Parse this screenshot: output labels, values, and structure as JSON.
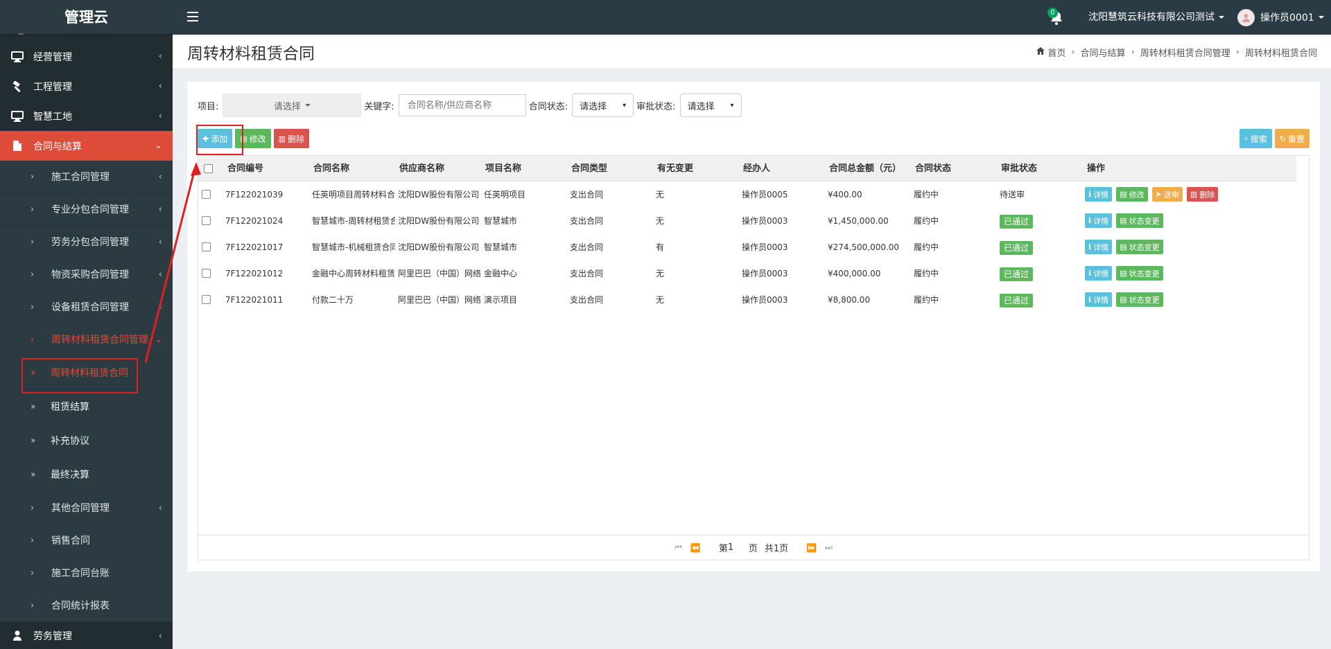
{
  "app": {
    "title": "管理云"
  },
  "sidebar": {
    "top_items": [
      {
        "label": "经营管理",
        "icon": "monitor-icon"
      },
      {
        "label": "工程管理",
        "icon": "hammer-icon"
      },
      {
        "label": "智慧工地",
        "icon": "monitor-icon"
      },
      {
        "label": "合同与结算",
        "icon": "document-icon"
      }
    ],
    "sub_items": [
      {
        "label": "施工合同管理"
      },
      {
        "label": "专业分包合同管理"
      },
      {
        "label": "劳务分包合同管理"
      },
      {
        "label": "物资采购合同管理"
      },
      {
        "label": "设备租赁合同管理"
      },
      {
        "label": "周转材料租赁合同管理"
      }
    ],
    "sub3_items": [
      {
        "label": "周转材料租赁合同"
      },
      {
        "label": "租赁结算"
      },
      {
        "label": "补充协议"
      },
      {
        "label": "最终决算"
      }
    ],
    "sub_items_after": [
      {
        "label": "其他合同管理"
      },
      {
        "label": "销售合同"
      },
      {
        "label": "施工合同台账"
      },
      {
        "label": "合同统计报表"
      }
    ],
    "bottom_item": {
      "label": "劳务管理",
      "icon": "person-icon"
    }
  },
  "topbar": {
    "notification_count": "0",
    "company": "沈阳慧筑云科技有限公司测试",
    "user": "操作员0001"
  },
  "page": {
    "title": "周转材料租赁合同",
    "breadcrumb": [
      "首页",
      "合同与结算",
      "周转材料租赁合同管理",
      "周转材料租赁合同"
    ]
  },
  "filters": {
    "project_label": "项目:",
    "project_value": "请选择",
    "keyword_label": "关键字:",
    "keyword_placeholder": "合同名称/供应商名称",
    "contract_status_label": "合同状态:",
    "contract_status_value": "请选择",
    "approval_status_label": "审批状态:",
    "approval_status_value": "请选择"
  },
  "toolbar": {
    "add": "添加",
    "edit": "修改",
    "delete": "删除",
    "search": "搜索",
    "reset": "重置"
  },
  "table": {
    "headers": [
      "合同编号",
      "合同名称",
      "供应商名称",
      "项目名称",
      "合同类型",
      "有无变更",
      "经办人",
      "合同总金额（元）",
      "合同状态",
      "审批状态",
      "操作"
    ],
    "rows": [
      {
        "code": "7F122021039",
        "name": "任英明项目周转材料合",
        "supplier": "沈阳DW股份有限公司",
        "project": "任英明项目",
        "type": "支出合同",
        "changed": "无",
        "handler": "操作员0005",
        "amount": "¥400.00",
        "status": "履约中",
        "approval": "待送审",
        "ops": [
          "详情",
          "修改",
          "送审",
          "删除"
        ]
      },
      {
        "code": "7F122021024",
        "name": "智慧城市-周转材租赁合",
        "supplier": "沈阳DW股份有限公司",
        "project": "智慧城市",
        "type": "支出合同",
        "changed": "无",
        "handler": "操作员0003",
        "amount": "¥1,450,000.00",
        "status": "履约中",
        "approval": "已通过",
        "ops": [
          "详情",
          "状态变更"
        ]
      },
      {
        "code": "7F122021017",
        "name": "智慧城市-机械租赁合同",
        "supplier": "沈阳DW股份有限公司",
        "project": "智慧城市",
        "type": "支出合同",
        "changed": "有",
        "handler": "操作员0003",
        "amount": "¥274,500,000.00",
        "status": "履约中",
        "approval": "已通过",
        "ops": [
          "详情",
          "状态变更"
        ]
      },
      {
        "code": "7F122021012",
        "name": "金融中心周转材料租赁",
        "supplier": "阿里巴巴（中国）网络",
        "project": "金融中心",
        "type": "支出合同",
        "changed": "无",
        "handler": "操作员0003",
        "amount": "¥400,000.00",
        "status": "履约中",
        "approval": "已通过",
        "ops": [
          "详情",
          "状态变更"
        ]
      },
      {
        "code": "7F122021011",
        "name": "付款二十万",
        "supplier": "阿里巴巴（中国）网络",
        "project": "演示项目",
        "type": "支出合同",
        "changed": "无",
        "handler": "操作员0003",
        "amount": "¥8,800.00",
        "status": "履约中",
        "approval": "已通过",
        "ops": [
          "详情",
          "状态变更"
        ]
      }
    ]
  },
  "pager": {
    "page_prefix": "第",
    "page": "1",
    "page_suffix": "页",
    "total": "共1页"
  },
  "colors": {
    "sidebar_bg": "#222d32",
    "active_red": "#dd4b39",
    "info": "#5bc0de",
    "success": "#5cb85c",
    "danger": "#d9534f",
    "warning": "#f0ad4e",
    "annotation": "#e02020"
  }
}
